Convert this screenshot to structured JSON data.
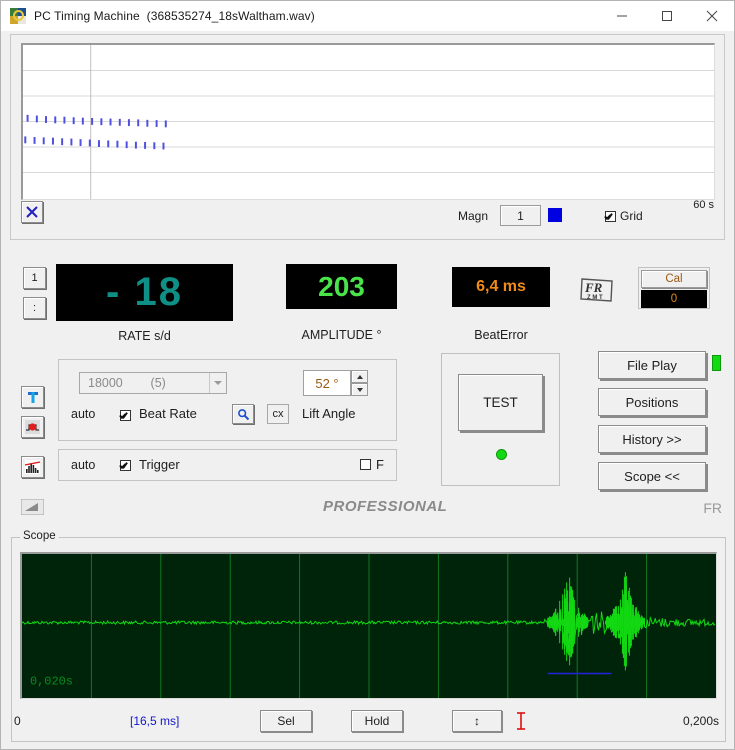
{
  "window": {
    "app_title": "PC Timing Machine",
    "file_name": "(368535274_18sWaltham.wav)",
    "minimize_label": "minimize",
    "maximize_label": "maximize",
    "close_label": "close"
  },
  "graph": {
    "magn_label": "Magn",
    "magn_value": "1",
    "trace_color": "#0000e0",
    "grid_label": "Grid",
    "grid_checked": true,
    "time_span": "60 s",
    "clear_button": "X"
  },
  "readouts": {
    "rate_value": "- 18",
    "rate_label": "RATE  s/d",
    "rate_color": "#0f8f85",
    "amplitude_value": "203",
    "amplitude_label": "AMPLITUDE  °",
    "amplitude_color": "#4ae44a",
    "beaterror_value": "6,4 ms",
    "beaterror_label": "BeatError",
    "beaterror_color": "#f08a18",
    "brand_logo": "FR ZMT",
    "cal_label": "Cal",
    "cal_value": "0"
  },
  "side_icons": {
    "counter": "1",
    "dots": ":",
    "trigger_icon": "T",
    "record_icon": "record",
    "histogram_icon": "histogram",
    "ramp_icon": "ramp"
  },
  "controls": {
    "beatrate_value": "18000        (5)",
    "auto_label_1": "auto",
    "beatrate_label": "Beat Rate",
    "beatrate_checked": true,
    "zoom_button": "search-icon",
    "cx_button": "cx",
    "liftangle_value": "52 °",
    "liftangle_label": "Lift Angle",
    "auto_label_2": "auto",
    "trigger_label": "Trigger",
    "trigger_checked": true,
    "f_label": "F",
    "f_checked": false
  },
  "test": {
    "button_label": "TEST",
    "led_color": "#13d913"
  },
  "right_buttons": [
    {
      "label": "File Play"
    },
    {
      "label": "Positions"
    },
    {
      "label": "History >>"
    },
    {
      "label": "Scope <<"
    }
  ],
  "branding": {
    "professional": "PROFESSIONAL",
    "fr": "FR"
  },
  "scope": {
    "group_label": "Scope",
    "time_marker": "0,020s",
    "start_time": "0",
    "selection_ms": "[16,5 ms]",
    "sel_button": "Sel",
    "hold_button": "Hold",
    "vscale_button": "↕",
    "cursor_icon": "i-beam-cursor",
    "end_time": "0,200s",
    "trace_color": "#13d913",
    "grid_color": "#0c7a22",
    "background": "#00240a",
    "marker_color": "#2222dd"
  },
  "chart_data": {
    "type": "scatter",
    "title": "",
    "xlabel": "",
    "ylabel": "",
    "xlim": [
      0,
      60
    ],
    "ylim": [
      0,
      5
    ],
    "grid": true,
    "series": [
      {
        "name": "trace-upper",
        "color": "#5050e0",
        "x": [
          0.4,
          1.2,
          2.0,
          2.8,
          3.6,
          4.4,
          5.2,
          6.0,
          6.8,
          7.6,
          8.4,
          9.2,
          10.0,
          10.8,
          11.6,
          12.4
        ],
        "y": [
          2.62,
          2.6,
          2.58,
          2.57,
          2.56,
          2.54,
          2.53,
          2.52,
          2.51,
          2.5,
          2.49,
          2.48,
          2.47,
          2.46,
          2.45,
          2.44
        ]
      },
      {
        "name": "trace-lower",
        "color": "#5050e0",
        "x": [
          0.2,
          1.0,
          1.8,
          2.6,
          3.4,
          4.2,
          5.0,
          5.8,
          6.6,
          7.4,
          8.2,
          9.0,
          9.8,
          10.6,
          11.4,
          12.2
        ],
        "y": [
          1.92,
          1.9,
          1.89,
          1.88,
          1.86,
          1.85,
          1.83,
          1.82,
          1.8,
          1.79,
          1.78,
          1.76,
          1.75,
          1.74,
          1.73,
          1.72
        ]
      }
    ]
  }
}
